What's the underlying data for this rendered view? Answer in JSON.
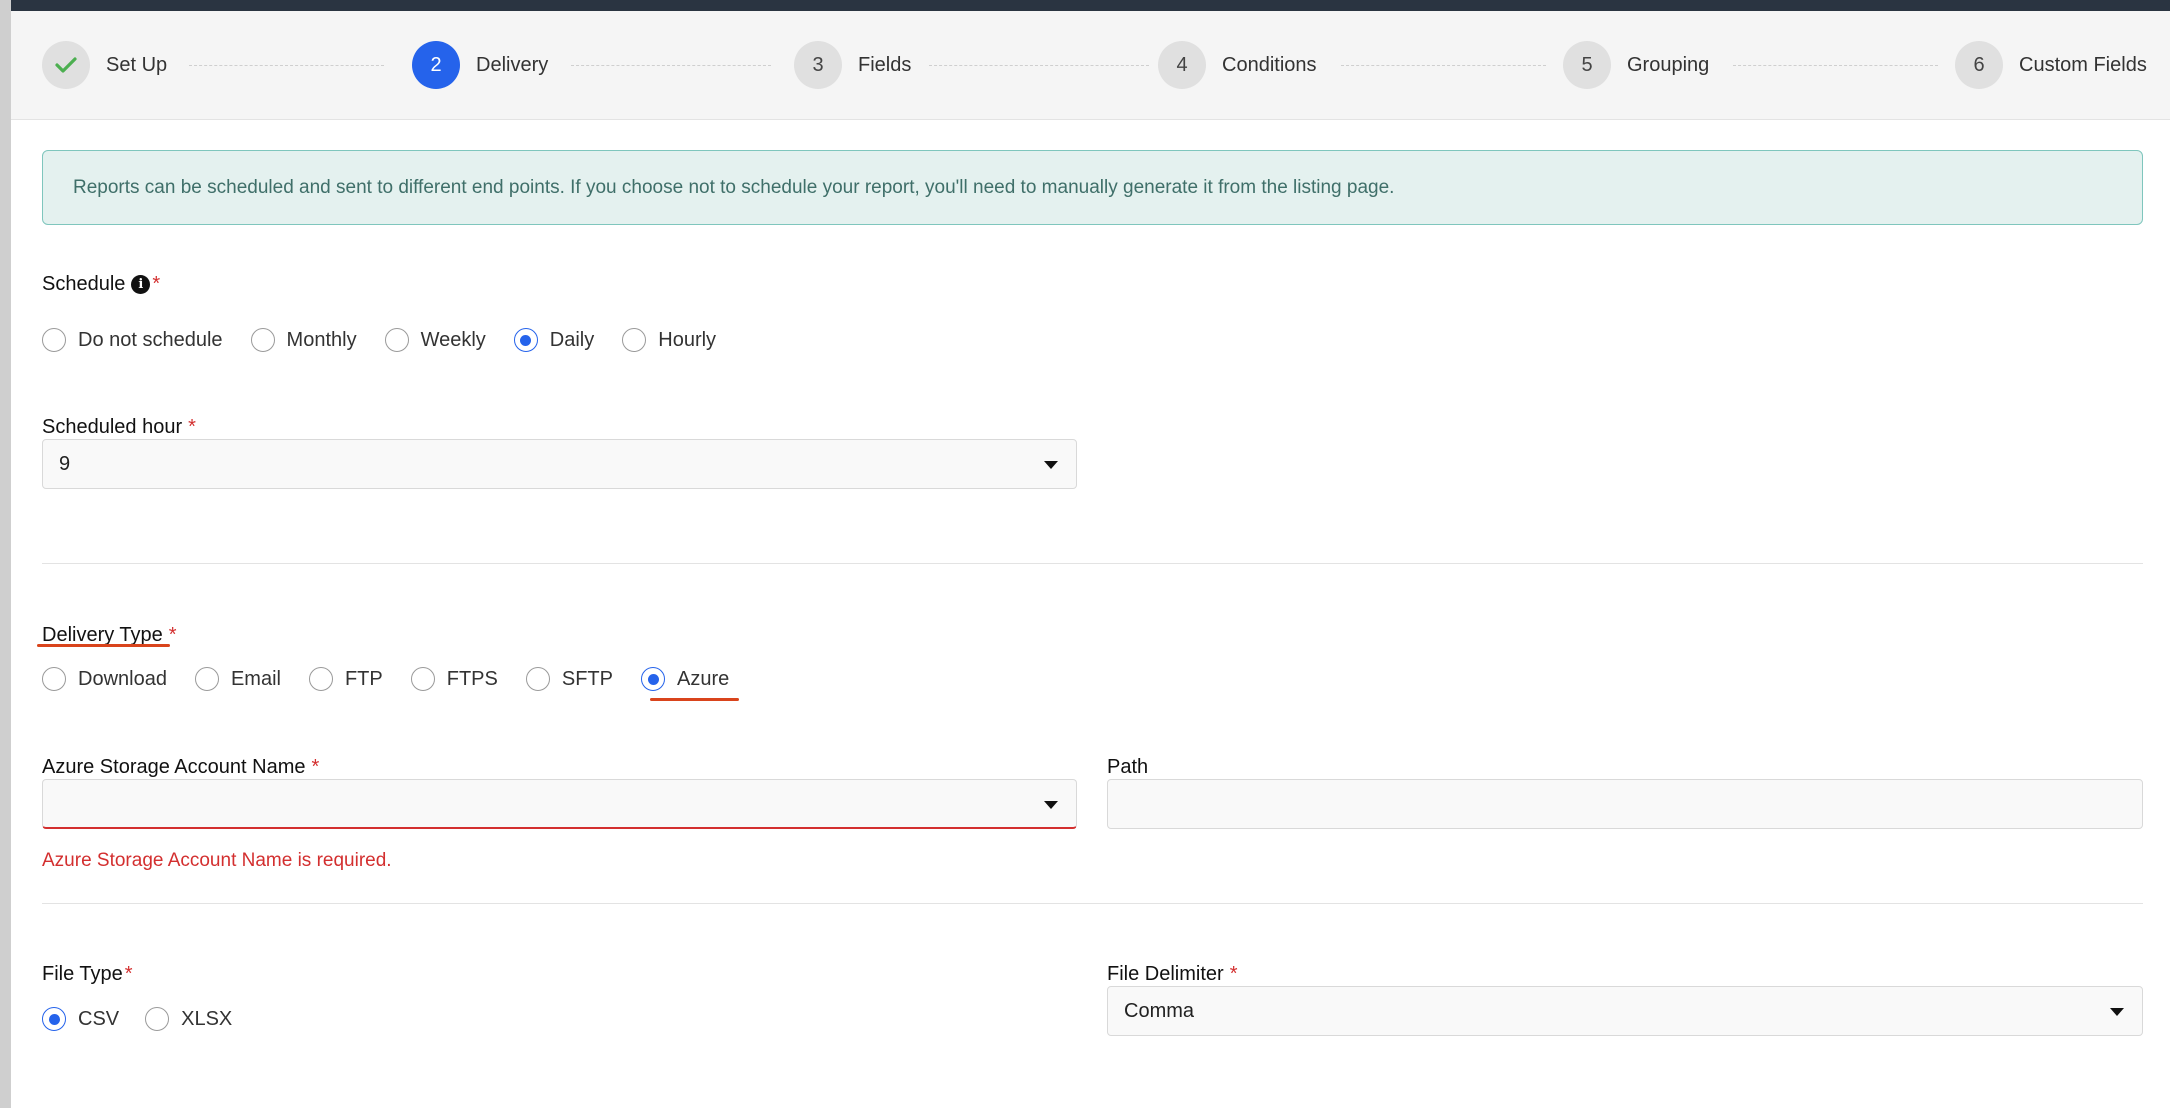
{
  "stepper": [
    {
      "number": "",
      "label": "Set Up",
      "state": "done",
      "icon": "check-icon"
    },
    {
      "number": "2",
      "label": "Delivery",
      "state": "active"
    },
    {
      "number": "3",
      "label": "Fields",
      "state": "pending"
    },
    {
      "number": "4",
      "label": "Conditions",
      "state": "pending"
    },
    {
      "number": "5",
      "label": "Grouping",
      "state": "pending"
    },
    {
      "number": "6",
      "label": "Custom Fields",
      "state": "pending"
    }
  ],
  "banner": {
    "text": "Reports can be scheduled and sent to different end points. If you choose not to schedule your report, you'll need to manually generate it from the listing page."
  },
  "schedule": {
    "label": "Schedule",
    "required_mark": "*",
    "info_icon": "info-icon",
    "options": [
      "Do not schedule",
      "Monthly",
      "Weekly",
      "Daily",
      "Hourly"
    ],
    "selected": "Daily"
  },
  "scheduled_hour": {
    "label": "Scheduled hour",
    "required_mark": "*",
    "value": "9"
  },
  "delivery_type": {
    "label": "Delivery Type",
    "required_mark": "*",
    "options": [
      "Download",
      "Email",
      "FTP",
      "FTPS",
      "SFTP",
      "Azure"
    ],
    "selected": "Azure"
  },
  "azure_account": {
    "label": "Azure Storage Account Name",
    "required_mark": "*",
    "value": "",
    "error": "Azure Storage Account Name is required."
  },
  "path": {
    "label": "Path",
    "value": ""
  },
  "file_type": {
    "label": "File Type",
    "required_mark": "*",
    "options": [
      "CSV",
      "XLSX"
    ],
    "selected": "CSV"
  },
  "file_delimiter": {
    "label": "File Delimiter",
    "required_mark": "*",
    "value": "Comma"
  },
  "colors": {
    "accent": "#2563eb",
    "error": "#d32f2f",
    "banner_bg": "#e4f1ef",
    "banner_border": "#7fc6bd"
  }
}
